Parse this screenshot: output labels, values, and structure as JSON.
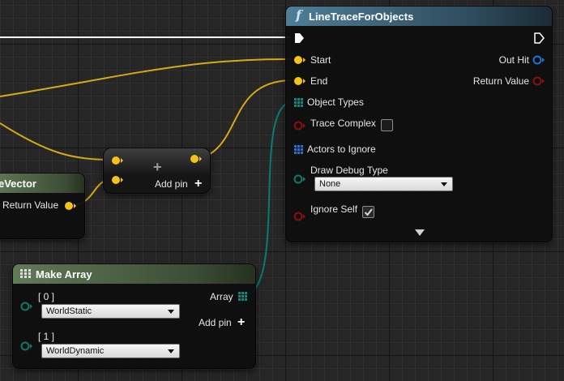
{
  "colors": {
    "vector_pin": "#f4c21b",
    "enum_pin": "#0b7a70",
    "bool_pin": "#8e0f0f",
    "object_pin": "#1f74d8",
    "node_body": "#0e0e0e",
    "function_header": "#4e7e97",
    "pure_header": "#617a57"
  },
  "line_trace": {
    "title": "LineTraceForObjects",
    "icon": "function-f-icon",
    "start_label": "Start",
    "end_label": "End",
    "object_types_label": "Object Types",
    "trace_complex_label": "Trace Complex",
    "trace_complex_checked": false,
    "actors_to_ignore_label": "Actors to Ignore",
    "draw_debug_type_label": "Draw Debug Type",
    "draw_debug_value": "None",
    "ignore_self_label": "Ignore Self",
    "ignore_self_checked": true,
    "out_hit_label": "Out Hit",
    "return_value_label": "Return Value"
  },
  "add_node": {
    "plus_symbol": "+",
    "add_pin_label": "Add pin",
    "add_pin_symbol": "+"
  },
  "vector_node": {
    "title_fragment": "eVector",
    "return_value_label": "Return Value"
  },
  "make_array": {
    "title": "Make Array",
    "index0_label": "[ 0 ]",
    "index0_value": "WorldStatic",
    "index1_label": "[ 1 ]",
    "index1_value": "WorldDynamic",
    "array_label": "Array",
    "add_pin_label": "Add pin",
    "add_pin_symbol": "+"
  }
}
